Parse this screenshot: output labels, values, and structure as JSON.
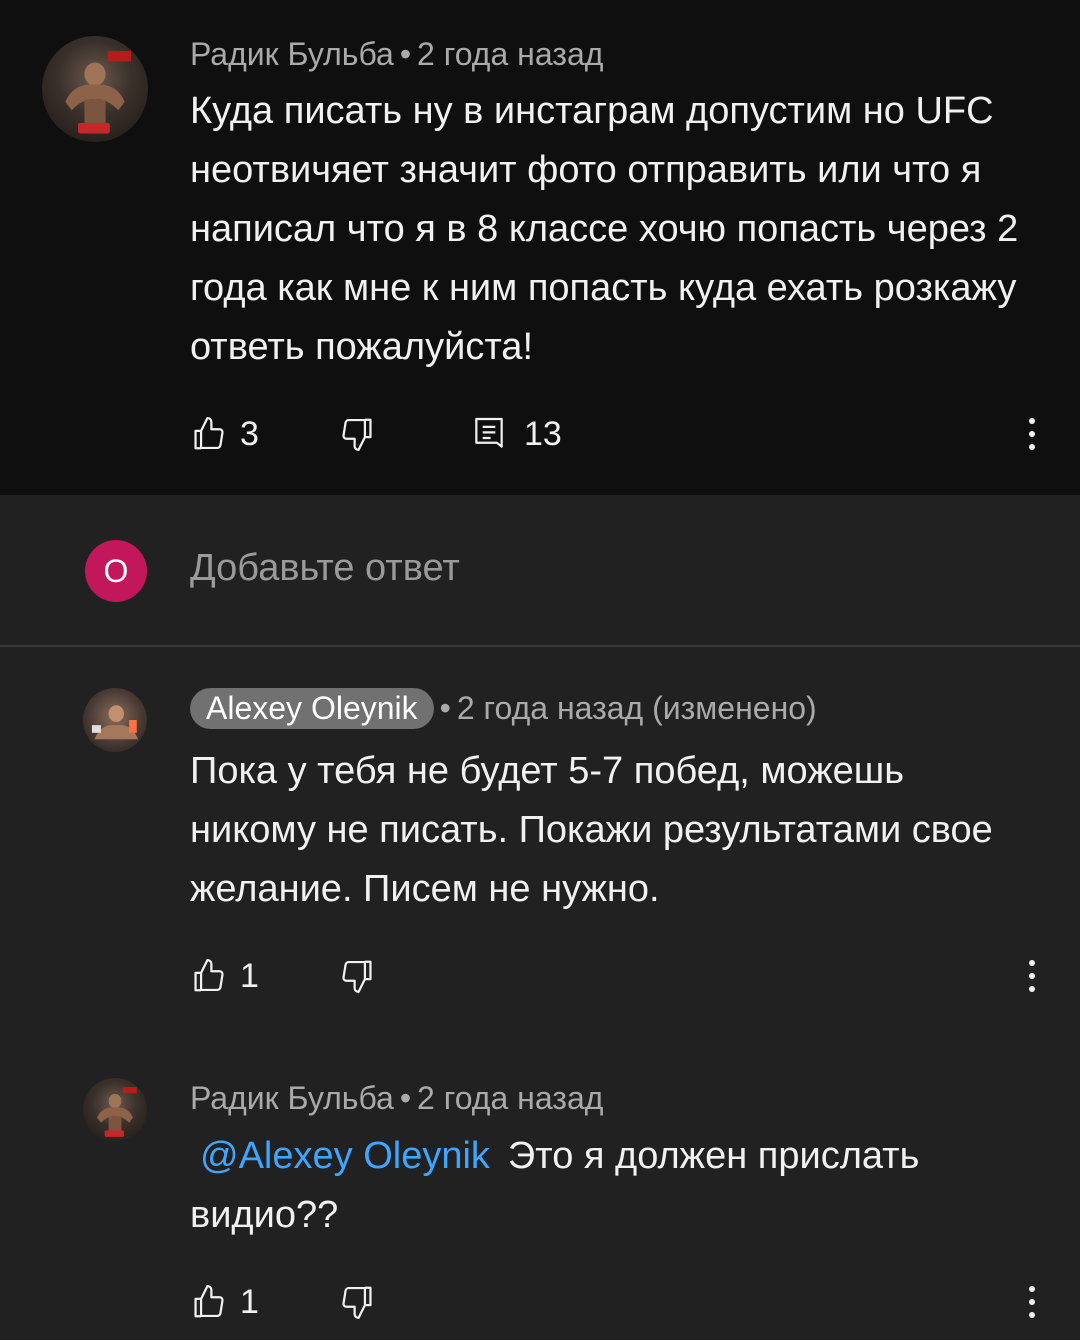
{
  "parent_comment": {
    "author": "Радик Бульба",
    "time": "2 года назад",
    "text": "Куда писать ну в инстаграм допустим но UFC неотвичяет значит фото отправить или что я написал что я в 8 классе хочю попасть через 2 года как мне к ним попасть куда ехать розкажу ответь пожалуйста!",
    "likes": "3",
    "replies": "13"
  },
  "reply_input": {
    "avatar_letter": "О",
    "placeholder": "Добавьте ответ",
    "avatar_color": "#c2185b"
  },
  "replies": [
    {
      "author": "Alexey Oleynik",
      "time": "2 года назад (изменено)",
      "text": "Пока у тебя не будет 5-7 побед, можешь никому не писать. Покажи результатами свое желание. Писем не нужно.",
      "likes": "1"
    },
    {
      "author": "Радик Бульба",
      "time": "2 года назад",
      "mention": "@Alexey Oleynik",
      "text": "Это я должен прислать видио??",
      "likes": "1"
    }
  ],
  "colors": {
    "background": "#212121",
    "parent_background": "#0f0f0f",
    "mention": "#3ea6ff",
    "secondary_text": "#aaaaaa"
  }
}
